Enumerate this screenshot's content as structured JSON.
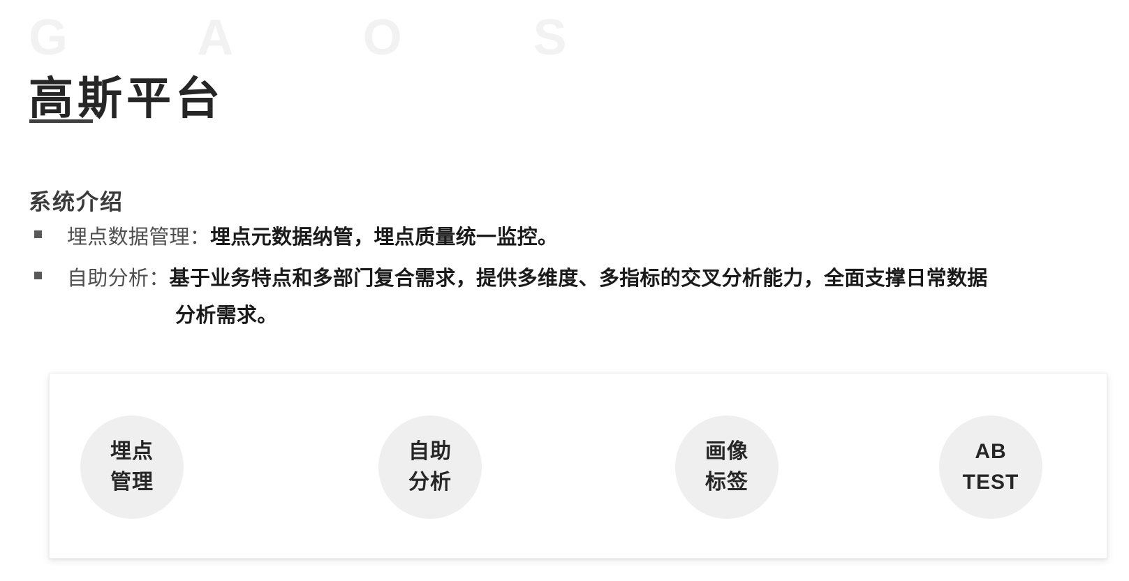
{
  "header": {
    "watermark": "G A O S",
    "title": "高斯平台"
  },
  "section": {
    "heading": "系统介绍",
    "bullets": [
      {
        "marker": "square-bullet",
        "label": "埋点数据管理：",
        "text": "埋点元数据纳管，埋点质量统一监控。",
        "continuation": ""
      },
      {
        "marker": "square-bullet",
        "label": "自助分析：",
        "text": "基于业务特点和多部门复合需求，提供多维度、多指标的交叉分析能力，全面支撑日常数据",
        "continuation": "分析需求。"
      }
    ]
  },
  "feature_card": {
    "circles": [
      {
        "name": "埋点管理",
        "line1": "埋点",
        "line2": "管理"
      },
      {
        "name": "自助分析",
        "line1": "自助",
        "line2": "分析"
      },
      {
        "name": "画像标签",
        "line1": "画像",
        "line2": "标签"
      },
      {
        "name": "AB TEST",
        "line1": "AB",
        "line2": "TEST"
      }
    ]
  },
  "colors": {
    "title": "#262626",
    "watermark": "#f2f2f2",
    "rule": "#404040",
    "heading": "#3b3b3b",
    "bullet_label": "#4f4f4f",
    "bullet_text": "#1a1a1a",
    "circle_bg": "#efefef",
    "card_bg": "#ffffff",
    "page_bg": "#ffffff"
  }
}
